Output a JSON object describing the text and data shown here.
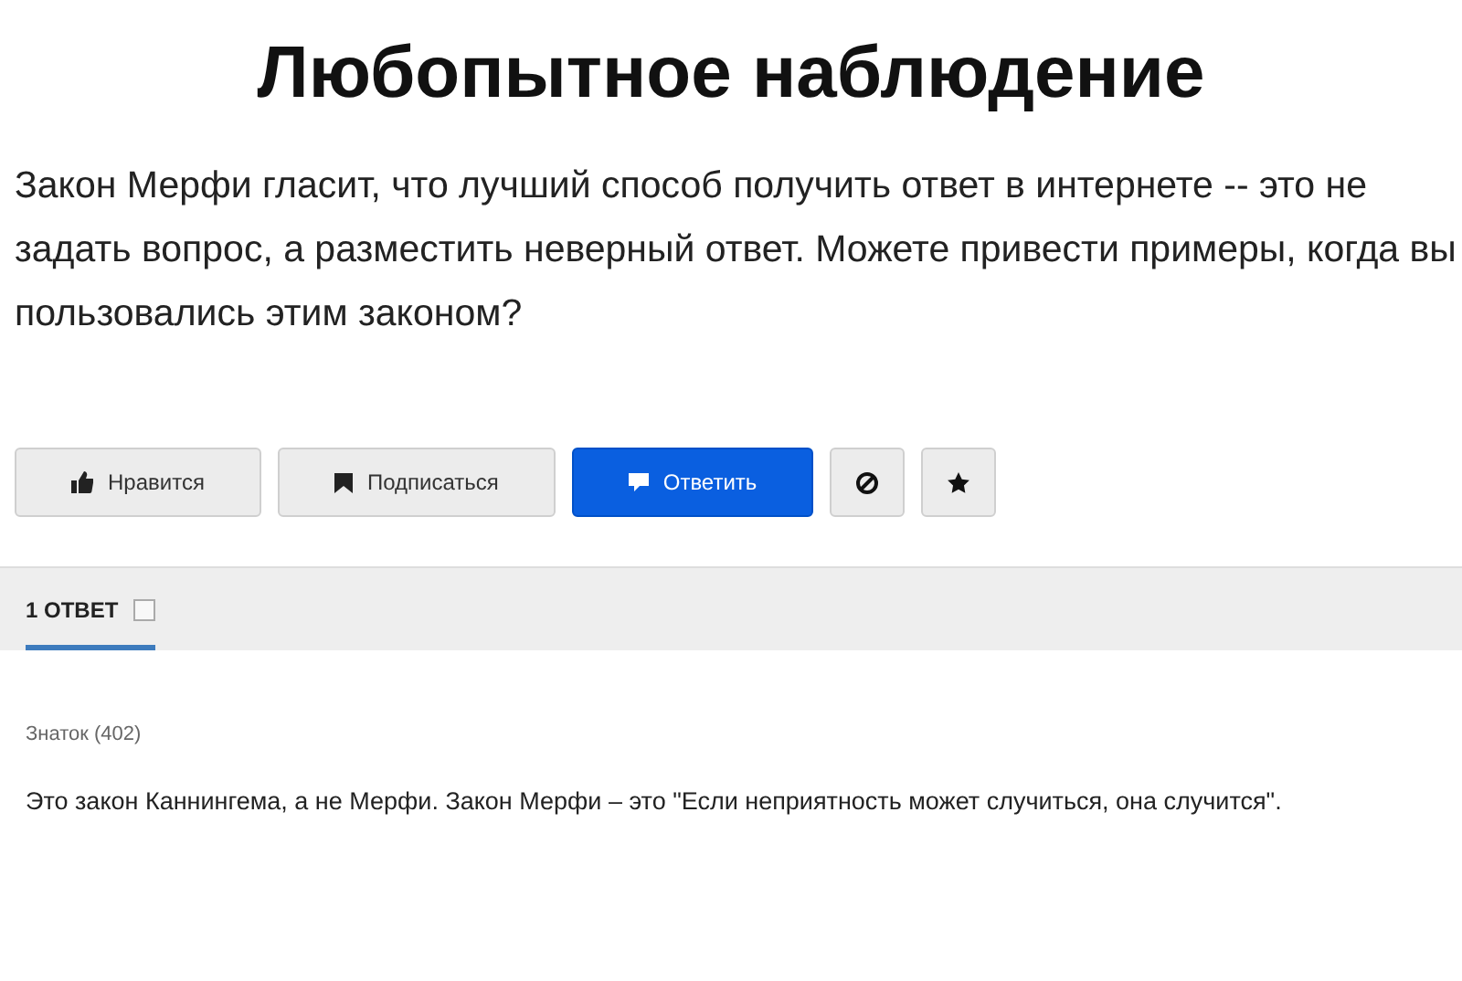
{
  "title": "Любопытное наблюдение",
  "question": "Закон Мерфи гласит, что лучший способ получить ответ в интернете -- это не задать вопрос, а разместить неверный ответ. Можете привести примеры, когда вы пользовались этим законом?",
  "actions": [
    {
      "kind": "text",
      "label": "Нравится",
      "primary": false
    },
    {
      "kind": "text",
      "label": "Подписаться",
      "primary": false
    },
    {
      "kind": "text",
      "label": "Ответить",
      "primary": true
    },
    {
      "kind": "icon",
      "primary": false
    },
    {
      "kind": "icon",
      "primary": false
    }
  ],
  "tabs": [
    {
      "label": "1 ОТВЕТ",
      "selected": true
    }
  ],
  "answers": [
    {
      "author": "Знаток (402)",
      "text": "Это закон Каннингема, а не Мерфи. Закон Мерфи – это \"Если неприятность может случиться, она случится\"."
    }
  ]
}
